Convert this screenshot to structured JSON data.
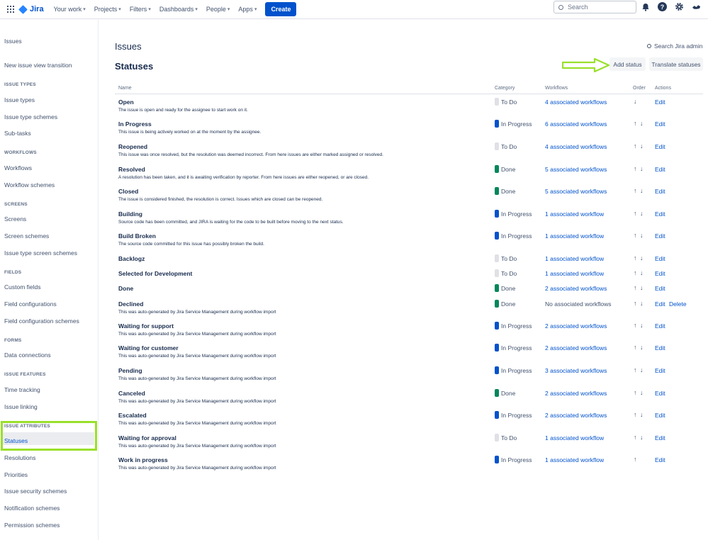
{
  "colors": {
    "brand": "#0052cc",
    "todo": "#dfe1e6",
    "in_progress": "#0052cc",
    "done": "#00875a",
    "annotation": "#9ae02a"
  },
  "topnav": {
    "logo": "Jira",
    "menu": [
      "Your work",
      "Projects",
      "Filters",
      "Dashboards",
      "People",
      "Apps"
    ],
    "create": "Create",
    "search_placeholder": "Search",
    "icons": [
      "notifications-icon",
      "help-icon",
      "settings-icon",
      "profile-icon"
    ]
  },
  "sidebar": {
    "title": "Issues",
    "top_items": [
      "New issue view transition"
    ],
    "sections": [
      {
        "header": "ISSUE TYPES",
        "items": [
          "Issue types",
          "Issue type schemes",
          "Sub-tasks"
        ]
      },
      {
        "header": "WORKFLOWS",
        "items": [
          "Workflows",
          "Workflow schemes"
        ]
      },
      {
        "header": "SCREENS",
        "items": [
          "Screens",
          "Screen schemes",
          "Issue type screen schemes"
        ]
      },
      {
        "header": "FIELDS",
        "items": [
          "Custom fields",
          "Field configurations",
          "Field configuration schemes"
        ]
      },
      {
        "header": "FORMS",
        "items": [
          "Data connections"
        ]
      },
      {
        "header": "ISSUE FEATURES",
        "items": [
          "Time tracking",
          "Issue linking"
        ]
      },
      {
        "header": "ISSUE ATTRIBUTES",
        "items": [
          "Statuses",
          "Resolutions",
          "Priorities",
          "Issue security schemes",
          "Notification schemes",
          "Permission schemes"
        ]
      }
    ],
    "selected": "Statuses"
  },
  "main": {
    "page_title": "Issues",
    "section_title": "Statuses",
    "admin_search": "Search Jira admin",
    "add_status": "Add status",
    "translate_statuses": "Translate statuses",
    "columns": {
      "name": "Name",
      "category": "Category",
      "workflows": "Workflows",
      "order": "Order",
      "actions": "Actions"
    },
    "rows": [
      {
        "name": "Open",
        "desc": "The issue is open and ready for the assignee to start work on it.",
        "category": "To Do",
        "cat": "todo",
        "workflows": "4 associated workflows",
        "order": "↓",
        "actions": [
          "Edit"
        ]
      },
      {
        "name": "In Progress",
        "desc": "This issue is being actively worked on at the moment by the assignee.",
        "category": "In Progress",
        "cat": "in_progress",
        "workflows": "6 associated workflows",
        "order": "↑ ↓",
        "actions": [
          "Edit"
        ]
      },
      {
        "name": "Reopened",
        "desc": "This issue was once resolved, but the resolution was deemed incorrect. From here issues are either marked assigned or resolved.",
        "category": "To Do",
        "cat": "todo",
        "workflows": "4 associated workflows",
        "order": "↑ ↓",
        "actions": [
          "Edit"
        ]
      },
      {
        "name": "Resolved",
        "desc": "A resolution has been taken, and it is awaiting verification by reporter. From here issues are either reopened, or are closed.",
        "category": "Done",
        "cat": "done",
        "workflows": "5 associated workflows",
        "order": "↑ ↓",
        "actions": [
          "Edit"
        ]
      },
      {
        "name": "Closed",
        "desc": "The issue is considered finished, the resolution is correct. Issues which are closed can be reopened.",
        "category": "Done",
        "cat": "done",
        "workflows": "5 associated workflows",
        "order": "↑ ↓",
        "actions": [
          "Edit"
        ]
      },
      {
        "name": "Building",
        "desc": "Source code has been committed, and JIRA is waiting for the code to be built before moving to the next status.",
        "category": "In Progress",
        "cat": "in_progress",
        "workflows": "1 associated workflow",
        "order": "↑ ↓",
        "actions": [
          "Edit"
        ]
      },
      {
        "name": "Build Broken",
        "desc": "The source code committed for this issue has possibly broken the build.",
        "category": "In Progress",
        "cat": "in_progress",
        "workflows": "1 associated workflow",
        "order": "↑ ↓",
        "actions": [
          "Edit"
        ]
      },
      {
        "name": "Backlogz",
        "desc": "",
        "category": "To Do",
        "cat": "todo",
        "workflows": "1 associated workflow",
        "order": "↑ ↓",
        "actions": [
          "Edit"
        ]
      },
      {
        "name": "Selected for Development",
        "desc": "",
        "category": "To Do",
        "cat": "todo",
        "workflows": "1 associated workflow",
        "order": "↑ ↓",
        "actions": [
          "Edit"
        ]
      },
      {
        "name": "Done",
        "desc": "",
        "category": "Done",
        "cat": "done",
        "workflows": "2 associated workflows",
        "order": "↑ ↓",
        "actions": [
          "Edit"
        ]
      },
      {
        "name": "Declined",
        "desc": "This was auto-generated by Jira Service Management during workflow import",
        "category": "Done",
        "cat": "done",
        "workflows": "No associated workflows",
        "order": "↑ ↓",
        "actions": [
          "Edit",
          "Delete"
        ]
      },
      {
        "name": "Waiting for support",
        "desc": "This was auto-generated by Jira Service Management during workflow import",
        "category": "In Progress",
        "cat": "in_progress",
        "workflows": "2 associated workflows",
        "order": "↑ ↓",
        "actions": [
          "Edit"
        ]
      },
      {
        "name": "Waiting for customer",
        "desc": "This was auto-generated by Jira Service Management during workflow import",
        "category": "In Progress",
        "cat": "in_progress",
        "workflows": "2 associated workflows",
        "order": "↑ ↓",
        "actions": [
          "Edit"
        ]
      },
      {
        "name": "Pending",
        "desc": "This was auto-generated by Jira Service Management during workflow import",
        "category": "In Progress",
        "cat": "in_progress",
        "workflows": "3 associated workflows",
        "order": "↑ ↓",
        "actions": [
          "Edit"
        ]
      },
      {
        "name": "Canceled",
        "desc": "This was auto-generated by Jira Service Management during workflow import",
        "category": "Done",
        "cat": "done",
        "workflows": "2 associated workflows",
        "order": "↑ ↓",
        "actions": [
          "Edit"
        ]
      },
      {
        "name": "Escalated",
        "desc": "This was auto-generated by Jira Service Management during workflow import",
        "category": "In Progress",
        "cat": "in_progress",
        "workflows": "2 associated workflows",
        "order": "↑ ↓",
        "actions": [
          "Edit"
        ]
      },
      {
        "name": "Waiting for approval",
        "desc": "This was auto-generated by Jira Service Management during workflow import",
        "category": "To Do",
        "cat": "todo",
        "workflows": "1 associated workflow",
        "order": "↑ ↓",
        "actions": [
          "Edit"
        ]
      },
      {
        "name": "Work in progress",
        "desc": "This was auto-generated by Jira Service Management during workflow import",
        "category": "In Progress",
        "cat": "in_progress",
        "workflows": "1 associated workflow",
        "order": "↑",
        "actions": [
          "Edit"
        ]
      }
    ]
  }
}
